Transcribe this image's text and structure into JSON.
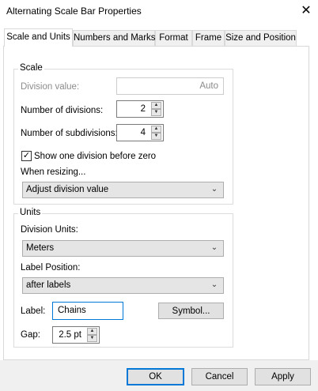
{
  "window": {
    "title": "Alternating Scale Bar Properties",
    "close_glyph": "✕"
  },
  "tabs": [
    {
      "label": "Scale and Units",
      "active": true
    },
    {
      "label": "Numbers and Marks",
      "active": false
    },
    {
      "label": "Format",
      "active": false
    },
    {
      "label": "Frame",
      "active": false
    },
    {
      "label": "Size and Position",
      "active": false
    }
  ],
  "scale": {
    "title": "Scale",
    "division_value": {
      "label": "Division value:",
      "value": "Auto"
    },
    "num_divisions": {
      "label": "Number of divisions:",
      "value": "2"
    },
    "num_subdivisions": {
      "label": "Number of subdivisions:",
      "value": "4"
    },
    "show_one_division": {
      "label": "Show one division before zero",
      "checked": true,
      "check_glyph": "✓"
    },
    "when_resizing": {
      "label": "When resizing...",
      "value": "Adjust division value"
    }
  },
  "units": {
    "title": "Units",
    "division_units": {
      "label": "Division Units:",
      "value": "Meters"
    },
    "label_position": {
      "label": "Label Position:",
      "value": "after labels"
    },
    "label": {
      "label": "Label:",
      "value": "Chains"
    },
    "symbol_button": "Symbol...",
    "gap": {
      "label": "Gap:",
      "value": "2.5 pt"
    }
  },
  "buttons": {
    "ok": "OK",
    "cancel": "Cancel",
    "apply": "Apply"
  },
  "glyphs": {
    "up": "▲",
    "down": "▼",
    "dropdown": "⌄"
  },
  "colors": {
    "accent": "#0078d7",
    "face": "#f0f0f0",
    "combo": "#e5e5e5"
  }
}
